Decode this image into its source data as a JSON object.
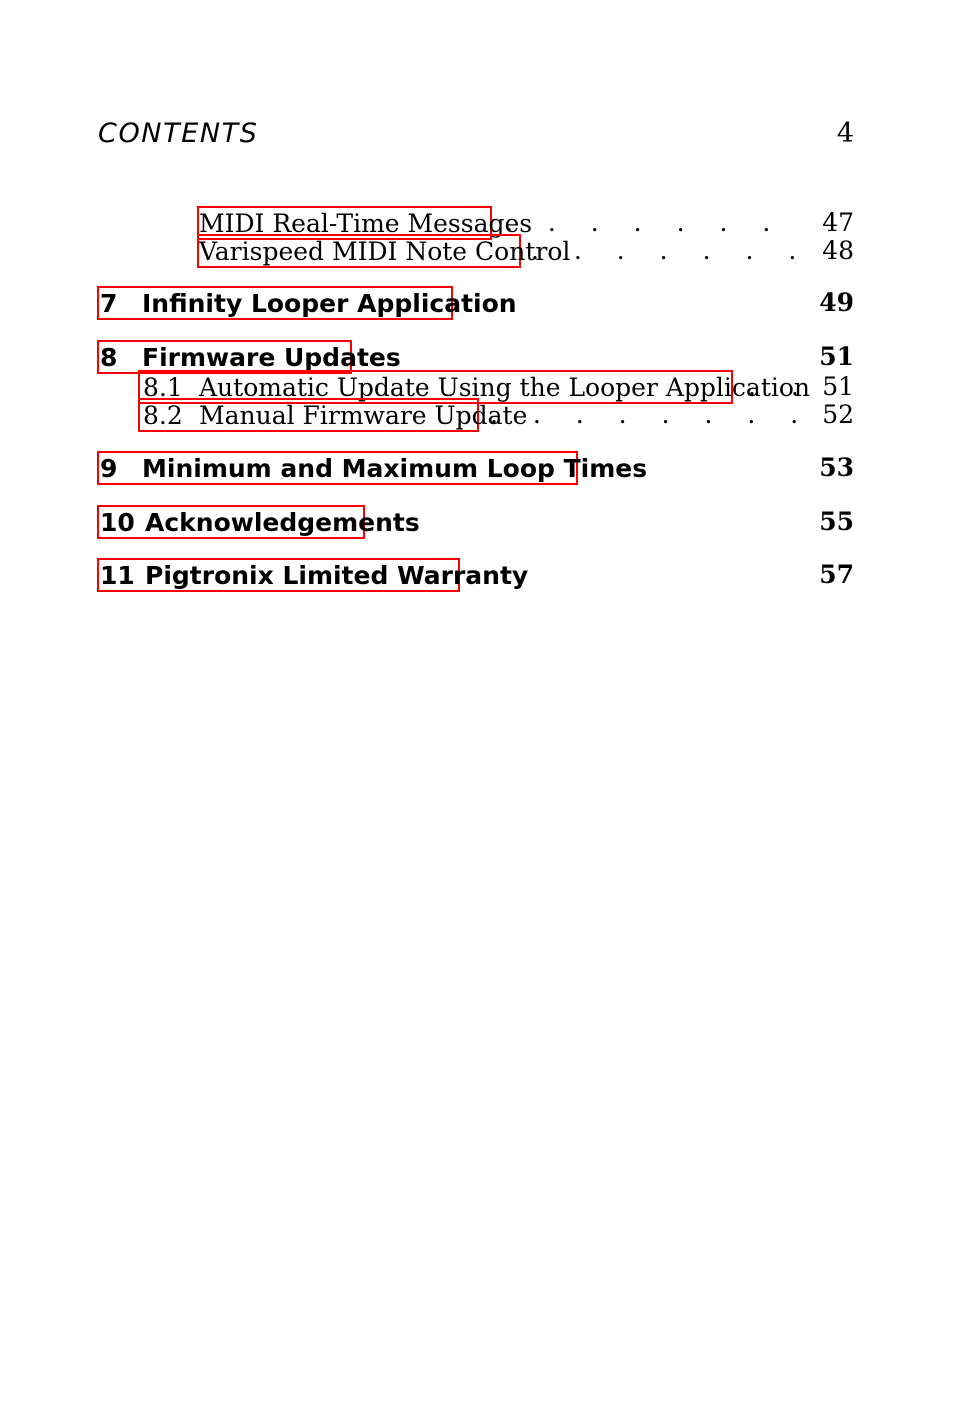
{
  "header": {
    "title": "CONTENTS",
    "page_number": "4"
  },
  "colors": {
    "annotation_box": "#FF0000",
    "text": "#000000",
    "background": "#FFFFFF"
  },
  "toc": {
    "entries": [
      {
        "level": "sub",
        "number": "",
        "title": "MIDI Real-Time Messages",
        "page": "47",
        "leader": ". . . . . . . . . . . . . ."
      },
      {
        "level": "sub",
        "number": "",
        "title": "Varispeed MIDI Note Control",
        "page": "48",
        "leader": ". . . . . . . . . . . . . ."
      },
      {
        "level": "chapter",
        "number": "7",
        "title": "Infinity Looper Application",
        "page": "49",
        "leader": ""
      },
      {
        "level": "chapter",
        "number": "8",
        "title": "Firmware Updates",
        "page": "51",
        "leader": ""
      },
      {
        "level": "section",
        "number": "8.1",
        "title": "Automatic Update Using the Looper Application",
        "page": "51",
        "leader": ". . ."
      },
      {
        "level": "section",
        "number": "8.2",
        "title": "Manual Firmware Update",
        "page": "52",
        "leader": ". . . . . . . . . . . . . ."
      },
      {
        "level": "chapter",
        "number": "9",
        "title": "Minimum and Maximum Loop Times",
        "page": "53",
        "leader": ""
      },
      {
        "level": "chapter",
        "number": "10",
        "title": "Acknowledgements",
        "page": "55",
        "leader": ""
      },
      {
        "level": "chapter",
        "number": "11",
        "title": "Pigtronix Limited Warranty",
        "page": "57",
        "leader": ""
      }
    ]
  }
}
